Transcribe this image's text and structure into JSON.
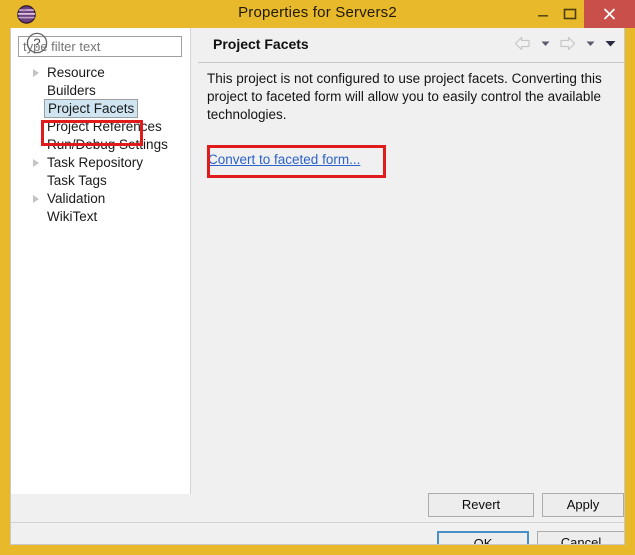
{
  "window": {
    "title": "Properties for Servers2",
    "icon": "eclipse-sphere-icon",
    "controls": {
      "minimize": "minimize-icon",
      "maximize": "maximize-icon",
      "close": "close-icon"
    },
    "accent_yellow": "#e8b92b",
    "close_red": "#c94f4b"
  },
  "sidebar": {
    "filter": {
      "value": "",
      "placeholder": "type filter text"
    },
    "items": [
      {
        "label": "Resource",
        "expandable": true,
        "selected": false
      },
      {
        "label": "Builders",
        "expandable": false,
        "selected": false
      },
      {
        "label": "Project Facets",
        "expandable": false,
        "selected": true
      },
      {
        "label": "Project References",
        "expandable": false,
        "selected": false
      },
      {
        "label": "Run/Debug Settings",
        "expandable": false,
        "selected": false
      },
      {
        "label": "Task Repository",
        "expandable": true,
        "selected": false
      },
      {
        "label": "Task Tags",
        "expandable": false,
        "selected": false
      },
      {
        "label": "Validation",
        "expandable": true,
        "selected": false
      },
      {
        "label": "WikiText",
        "expandable": false,
        "selected": false
      }
    ]
  },
  "page": {
    "title": "Project Facets",
    "description": "This project is not configured to use project facets. Converting this project to faceted form will allow you to easily control the available technologies.",
    "link_label": "Convert to faceted form...",
    "nav": {
      "back": "back-arrow-icon",
      "back_menu": "chevron-down-icon",
      "forward": "forward-arrow-icon",
      "forward_menu": "chevron-down-icon",
      "view_menu": "chevron-down-icon"
    }
  },
  "buttons": {
    "revert": "Revert",
    "apply": "Apply",
    "ok": "OK",
    "cancel": "Cancel"
  },
  "footer": {
    "help": "help-icon"
  },
  "annotations": {
    "color": "#e01b1b",
    "regions": [
      "project-facets-tree-item",
      "convert-to-faceted-form-link"
    ]
  }
}
